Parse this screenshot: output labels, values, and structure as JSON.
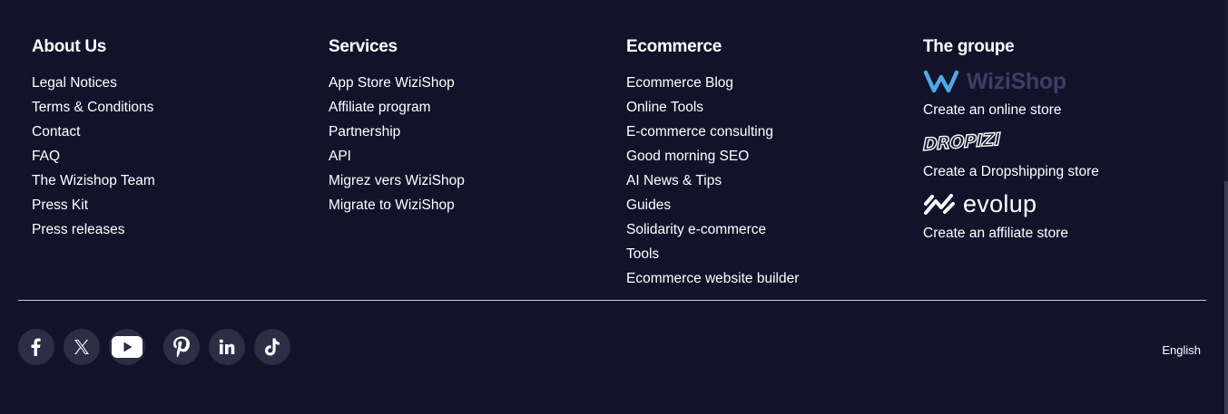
{
  "columns": [
    {
      "title": "About Us",
      "links": [
        "Legal Notices",
        "Terms & Conditions",
        "Contact",
        "FAQ",
        "The Wizishop Team",
        "Press Kit",
        "Press releases"
      ]
    },
    {
      "title": "Services",
      "links": [
        "App Store WiziShop",
        "Affiliate program",
        "Partnership",
        "API",
        "Migrez vers WiziShop",
        "Migrate to WiziShop"
      ]
    },
    {
      "title": "Ecommerce",
      "links": [
        "Ecommerce Blog",
        "Online Tools",
        "E-commerce consulting",
        "Good morning SEO",
        "AI News & Tips",
        "Guides",
        "Solidarity e-commerce",
        "Tools",
        "Ecommerce website builder"
      ]
    }
  ],
  "groupe": {
    "title": "The groupe",
    "brands": [
      {
        "logo": "WiziShop",
        "caption": "Create an online store"
      },
      {
        "logo": "DROPIZI",
        "caption": "Create a Dropshipping store"
      },
      {
        "logo": "evolup",
        "caption": "Create an affiliate store"
      }
    ]
  },
  "social": [
    "facebook-icon",
    "x-icon",
    "youtube-icon",
    "pinterest-icon",
    "linkedin-icon",
    "tiktok-icon"
  ],
  "language": "English",
  "colors": {
    "background": "#12132b",
    "social_bg": "#2c2e45",
    "wizishop_blue": "#4fa9e3",
    "wizishop_text": "#3a3f63"
  }
}
